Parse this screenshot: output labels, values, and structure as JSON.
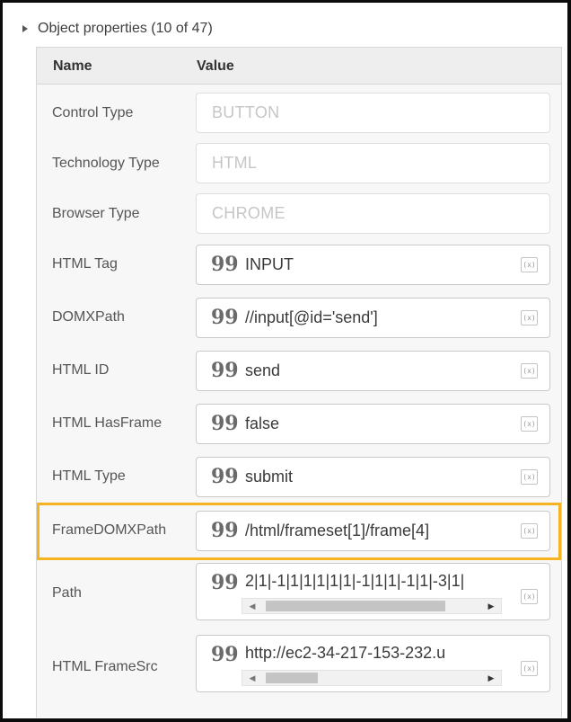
{
  "section": {
    "title": "Object properties (10 of 47)"
  },
  "columns": {
    "name": "Name",
    "value": "Value"
  },
  "rows": [
    {
      "label": "Control Type",
      "placeholder": "BUTTON"
    },
    {
      "label": "Technology Type",
      "placeholder": "HTML"
    },
    {
      "label": "Browser Type",
      "placeholder": "CHROME"
    },
    {
      "label": "HTML Tag",
      "value": "INPUT"
    },
    {
      "label": "DOMXPath",
      "value": "//input[@id='send']"
    },
    {
      "label": "HTML ID",
      "value": "send"
    },
    {
      "label": "HTML HasFrame",
      "value": "false"
    },
    {
      "label": "HTML Type",
      "value": "submit"
    },
    {
      "label": "FrameDOMXPath",
      "value": "/html/frameset[1]/frame[4]"
    },
    {
      "label": "Path",
      "value": "2|1|-1|1|1|1|1|1|-1|1|1|-1|1|-3|1|"
    },
    {
      "label": "HTML FrameSrc",
      "value": "http://ec2-34-217-153-232.u"
    }
  ],
  "icons": {
    "quote": "99",
    "variable": "(x)",
    "arrow_left": "◀",
    "arrow_right": "▶"
  },
  "colors": {
    "highlight": "#f5b320"
  }
}
